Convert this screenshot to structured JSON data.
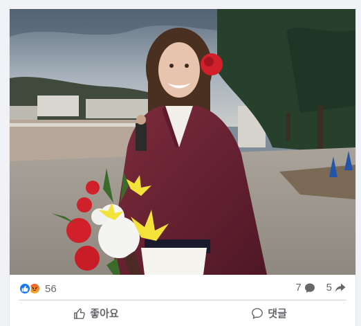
{
  "post": {
    "reaction_icons": [
      "like-icon",
      "angry-icon"
    ],
    "reaction_count": "56",
    "comment_count": "7",
    "share_count": "5"
  },
  "actions": {
    "like_label": "좋아요",
    "comment_label": "댓글"
  },
  "colors": {
    "like_blue": "#1877f2",
    "text_secondary": "#65676b",
    "divider": "#ced0d4"
  }
}
